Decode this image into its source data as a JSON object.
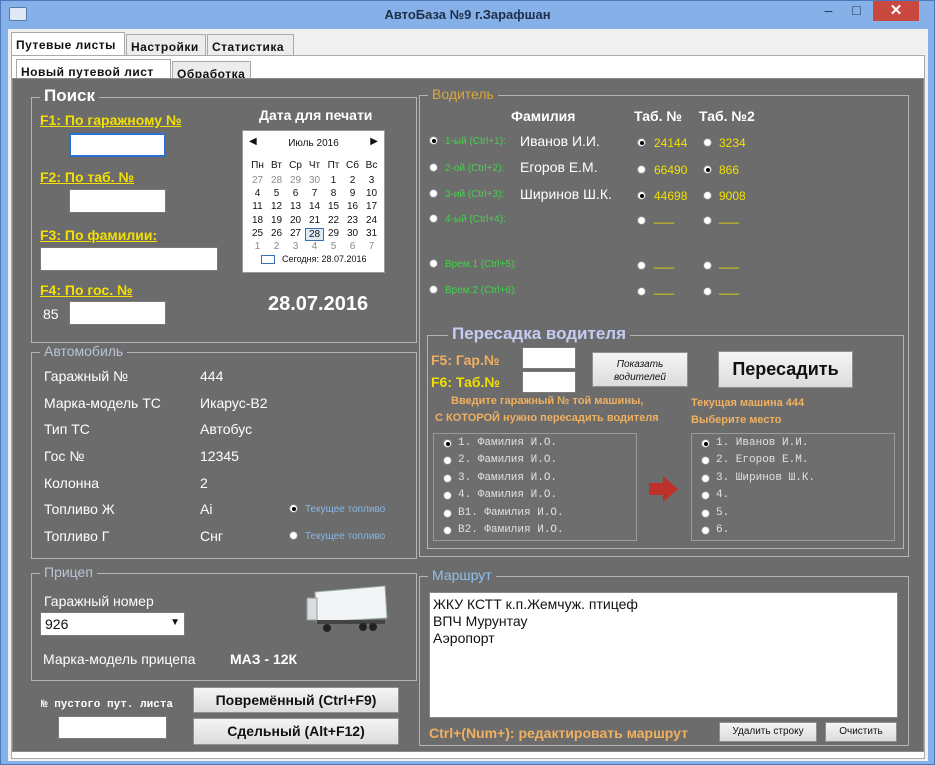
{
  "window": {
    "title": "АвтоБаза №9 г.Зарафшан",
    "minimize": "–",
    "maximize": "□",
    "close": "✕"
  },
  "tabs_top": [
    "Путевые листы",
    "Настройки",
    "Статистика"
  ],
  "tabs_sub": [
    "Новый путевой лист",
    "Обработка"
  ],
  "search": {
    "title": "Поиск",
    "f1": "F1: По гаражному №",
    "f2": "F2: По таб. №",
    "f3": "F3: По фамилии:",
    "f4": "F4: По гос. №",
    "region": "85",
    "print_date_label": "Дата для печати",
    "print_date": "28.07.2016"
  },
  "calendar": {
    "month": "Июль 2016",
    "prev": "◀",
    "next": "▶",
    "weekdays": [
      "Пн",
      "Вт",
      "Ср",
      "Чт",
      "Пт",
      "Сб",
      "Вс"
    ],
    "weeks": [
      [
        "27",
        "28",
        "29",
        "30",
        "1",
        "2",
        "3"
      ],
      [
        "4",
        "5",
        "6",
        "7",
        "8",
        "9",
        "10"
      ],
      [
        "11",
        "12",
        "13",
        "14",
        "15",
        "16",
        "17"
      ],
      [
        "18",
        "19",
        "20",
        "21",
        "22",
        "23",
        "24"
      ],
      [
        "25",
        "26",
        "27",
        "28",
        "29",
        "30",
        "31"
      ],
      [
        "1",
        "2",
        "3",
        "4",
        "5",
        "6",
        "7"
      ]
    ],
    "today": "Сегодня: 28.07.2016"
  },
  "car": {
    "title": "Автомобиль",
    "rows": [
      {
        "label": "Гаражный №",
        "value": "444"
      },
      {
        "label": "Марка-модель ТС",
        "value": "Икарус-В2"
      },
      {
        "label": "Тип ТС",
        "value": "Автобус"
      },
      {
        "label": "Гос №",
        "value": "12345"
      },
      {
        "label": "Колонна",
        "value": "2"
      },
      {
        "label": "Топливо Ж",
        "value": "Ai"
      },
      {
        "label": "Топливо Г",
        "value": "Снг"
      }
    ],
    "fuel_current": "Текущее топливо"
  },
  "trailer": {
    "title": "Прицеп",
    "garage_label": "Гаражный номер",
    "garage_value": "926",
    "model_label": "Марка-модель прицепа",
    "model_value": "МАЗ - 12К"
  },
  "bottom": {
    "empty_label": "№ пустого пут. листа",
    "btn_time": "Повремённый (Ctrl+F9)",
    "btn_piece": "Сдельный (Alt+F12)"
  },
  "driver": {
    "title": "Водитель",
    "col_name": "Фамилия",
    "col_tab": "Таб. №",
    "col_tab2": "Таб. №2",
    "rows": [
      {
        "slot": "1-ый (Ctrl+1):",
        "name": "Иванов И.И.",
        "tab": "24144",
        "tab2": "3234"
      },
      {
        "slot": "2-ой (Ctrl+2):",
        "name": "Егоров Е.М.",
        "tab": "66490",
        "tab2": "866"
      },
      {
        "slot": "3-ий (Ctrl+3):",
        "name": "Ширинов Ш.К.",
        "tab": "44698",
        "tab2": "9008"
      },
      {
        "slot": "4-ый (Ctrl+4):",
        "name": "",
        "tab": "___",
        "tab2": "___"
      },
      {
        "slot": "Врем.1 (Ctrl+5):",
        "name": "",
        "tab": "___",
        "tab2": "___"
      },
      {
        "slot": "Врем.2 (Ctrl+6):",
        "name": "",
        "tab": "___",
        "tab2": "___"
      }
    ]
  },
  "transfer": {
    "title": "Пересадка водителя",
    "f5": "F5: Гар.№",
    "f6": "F6: Таб.№",
    "show_btn": "Показать водителей",
    "transfer_btn": "Пересадить",
    "hint1": "Введите гаражный № той машины,",
    "hint2": "С КОТОРОЙ нужно пересадить водителя",
    "current1": "Текущая машина  444",
    "current2": "Выберите место",
    "left_list": [
      "1. Фамилия И.О.",
      "2. Фамилия И.О.",
      "3. Фамилия И.О.",
      "4. Фамилия И.О.",
      "В1. Фамилия И.О.",
      "В2. Фамилия И.О."
    ],
    "right_list": [
      "1. Иванов И.И.",
      "2. Егоров Е.М.",
      "3. Ширинов Ш.К.",
      "4.",
      "5.",
      "6."
    ]
  },
  "route": {
    "title": "Маршрут",
    "lines": [
      "ЖКУ КСТТ к.п.Жемчуж. птицеф",
      "ВПЧ Мурунтау",
      "Аэропорт"
    ],
    "hint": "Ctrl+(Num+): редактировать маршрут",
    "del_btn": "Удалить строку",
    "clear_btn": "Очистить"
  }
}
